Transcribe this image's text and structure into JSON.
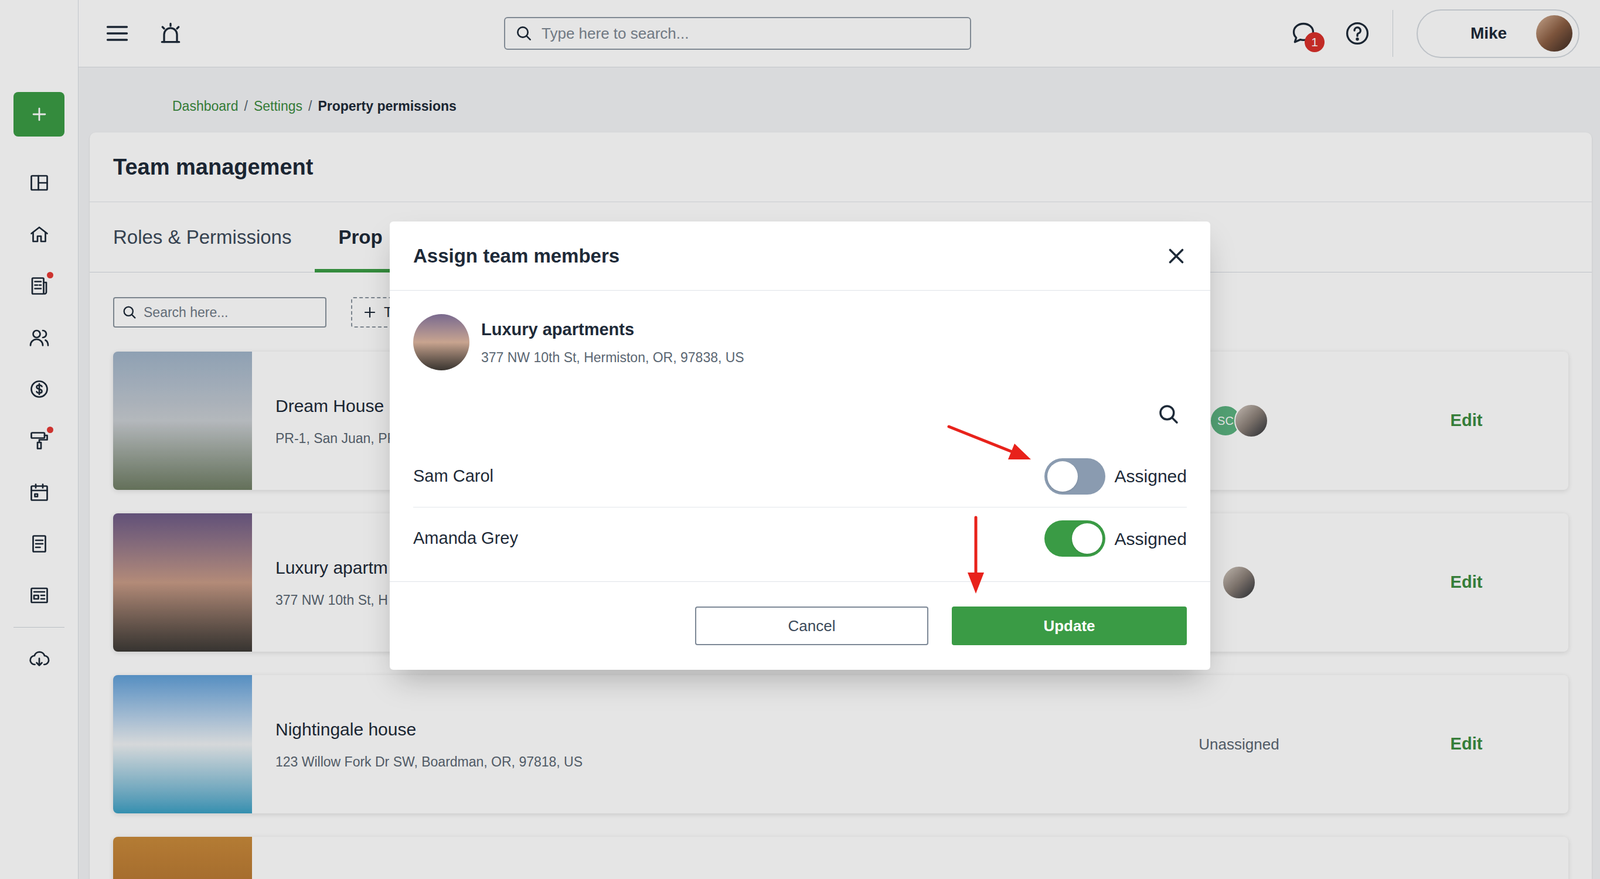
{
  "sidebar": {
    "items": [
      {
        "dot": false
      },
      {
        "dot": false
      },
      {
        "dot": true
      },
      {
        "dot": false
      },
      {
        "dot": false
      },
      {
        "dot": true
      },
      {
        "dot": false
      },
      {
        "dot": false
      },
      {
        "dot": false
      },
      {
        "dot": false
      }
    ]
  },
  "topbar": {
    "search": {
      "placeholder": "Type here to search..."
    },
    "notifications": "1",
    "user": "Mike"
  },
  "breadcrumb": {
    "separator": "/",
    "items": [
      {
        "label": "Dashboard",
        "current": false
      },
      {
        "label": "Settings",
        "current": false
      },
      {
        "label": "Property permissions",
        "current": true
      }
    ]
  },
  "page": {
    "title": "Team management",
    "tabs": [
      {
        "label": "Roles & Permissions",
        "selected": false
      },
      {
        "label": "Prop",
        "selected": true
      }
    ],
    "search": {
      "placeholder": "Search here..."
    },
    "add_button": "T"
  },
  "properties": [
    {
      "name": "Dream House",
      "address": "PR-1, San Juan, PR",
      "assignees": [
        {
          "kind": "initials",
          "initials": "SC",
          "color": "#5cb381"
        },
        {
          "kind": "photo"
        }
      ],
      "action": "Edit"
    },
    {
      "name": "Luxury apartm",
      "address": "377 NW 10th St, H",
      "assignees": [
        {
          "kind": "photo"
        }
      ],
      "action": "Edit"
    },
    {
      "name": "Nightingale house",
      "address": "123 Willow Fork Dr SW, Boardman, OR, 97818, US",
      "assignees": [],
      "unassigned_label": "Unassigned",
      "action": "Edit"
    }
  ],
  "modal": {
    "title": "Assign team members",
    "property": {
      "name": "Luxury apartments",
      "address": "377 NW 10th St, Hermiston, OR, 97838, US"
    },
    "members": [
      {
        "name": "Sam Carol",
        "assigned": false,
        "label": "Assigned"
      },
      {
        "name": "Amanda Grey",
        "assigned": true,
        "label": "Assigned"
      }
    ],
    "buttons": {
      "cancel": "Cancel",
      "update": "Update"
    }
  }
}
